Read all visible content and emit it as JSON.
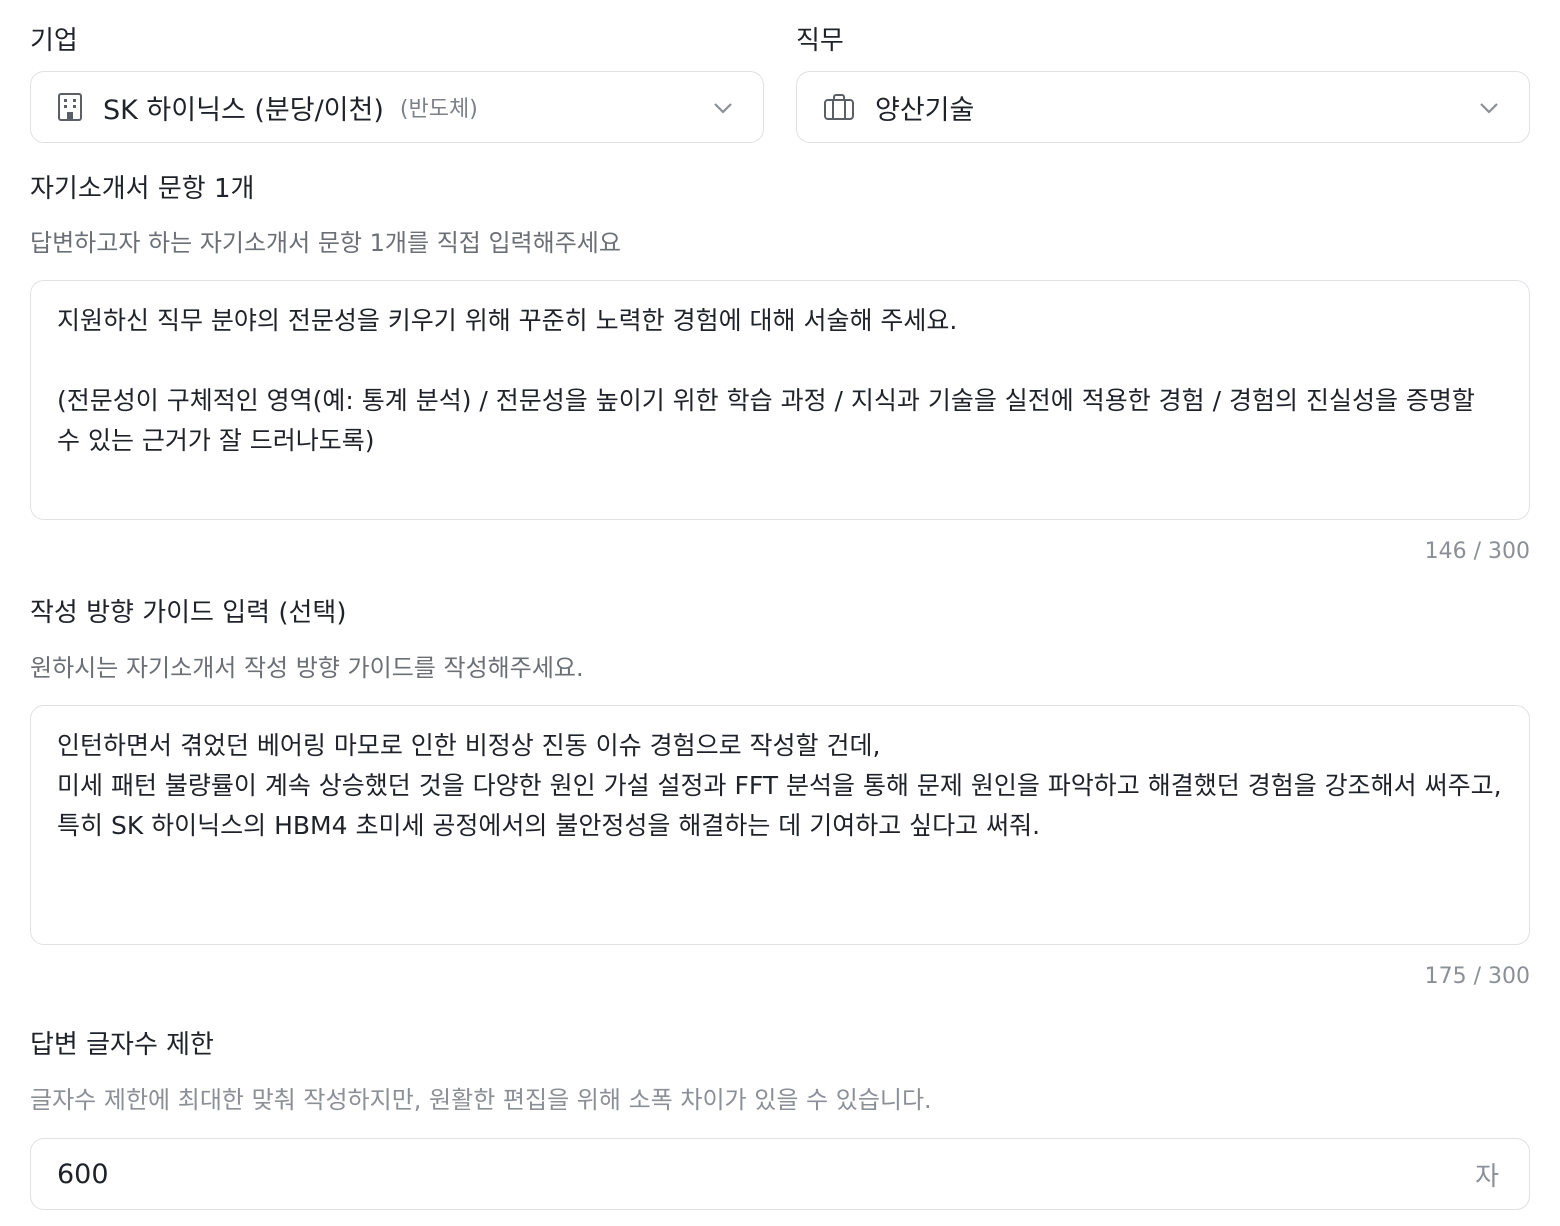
{
  "company": {
    "label": "기업",
    "value": "SK 하이닉스 (분당/이천)",
    "sub": "(반도체)",
    "icon": "building-icon"
  },
  "job": {
    "label": "직무",
    "value": "양산기술",
    "icon": "briefcase-icon"
  },
  "question": {
    "label": "자기소개서 문항 1개",
    "helper": "답변하고자 하는 자기소개서 문항 1개를 직접 입력해주세요",
    "value": "지원하신 직무 분야의 전문성을 키우기 위해 꾸준히 노력한 경험에 대해 서술해 주세요.\n\n(전문성이 구체적인 영역(예: 통계 분석) / 전문성을 높이기 위한 학습 과정 / 지식과 기술을 실전에 적용한 경험 / 경험의 진실성을 증명할 수 있는 근거가 잘 드러나도록)",
    "counter": "146 / 300"
  },
  "guide": {
    "label": "작성 방향 가이드 입력 (선택)",
    "helper": "원하시는 자기소개서 작성 방향 가이드를 작성해주세요.",
    "value": "인턴하면서 겪었던 베어링 마모로 인한 비정상 진동 이슈 경험으로 작성할 건데,\n미세 패턴 불량률이 계속 상승했던 것을 다양한 원인 가설 설정과 FFT 분석을 통해 문제 원인을 파악하고 해결했던 경험을 강조해서 써주고, 특히 SK 하이닉스의 HBM4 초미세 공정에서의 불안정성을 해결하는 데 기여하고 싶다고 써줘.",
    "counter": "175 / 300"
  },
  "limit": {
    "label": "답변 글자수 제한",
    "helper": "글자수 제한에 최대한 맞춰 작성하지만, 원활한 편집을 위해 소폭 차이가 있을 수 있습니다.",
    "value": "600",
    "unit": "자"
  },
  "colors": {
    "border": "#dfe1e5",
    "text": "#1f2329",
    "muted": "#8b8f96"
  }
}
